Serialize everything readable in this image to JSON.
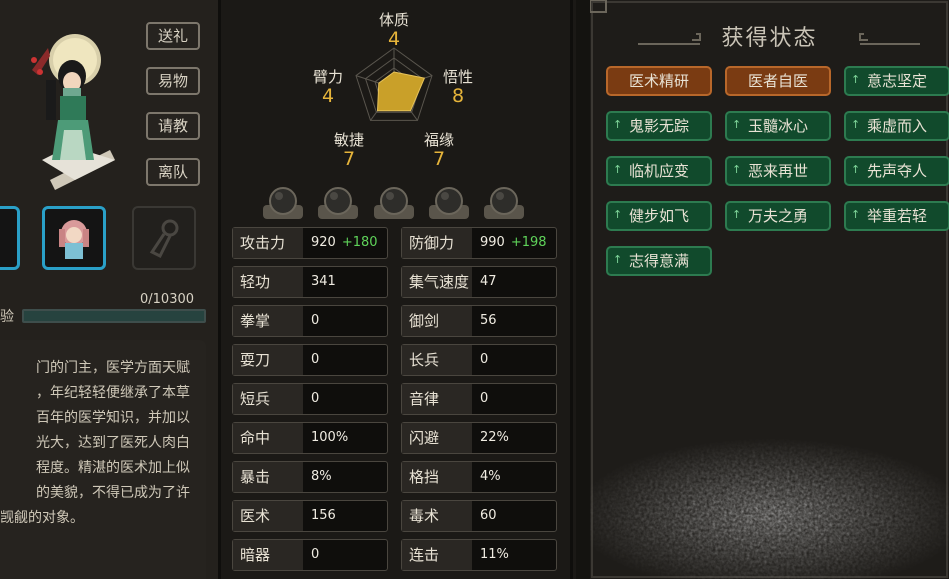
{
  "side_buttons": [
    "送礼",
    "易物",
    "请教",
    "离队"
  ],
  "xp": {
    "label": "验",
    "value": "0/10300",
    "fraction": 0.0
  },
  "bio": {
    "lines": [
      "门的门主，医学方面天赋",
      "，年纪轻轻便继承了本草",
      "百年的医学知识，并加以",
      "光大，达到了医死人肉白",
      "程度。精湛的医术加上似",
      "的美貌，不得已成为了许",
      "觊觎的对象。"
    ]
  },
  "radar": {
    "attributes": [
      {
        "name": "体质",
        "value": "4"
      },
      {
        "name": "悟性",
        "value": "8"
      },
      {
        "name": "福缘",
        "value": "7"
      },
      {
        "name": "敏捷",
        "value": "7"
      },
      {
        "name": "臂力",
        "value": "4"
      }
    ],
    "max": 10
  },
  "stats": [
    [
      {
        "name": "攻击力",
        "value": "920",
        "bonus": "+180"
      },
      {
        "name": "防御力",
        "value": "990",
        "bonus": "+198"
      }
    ],
    [
      {
        "name": "轻功",
        "value": "341"
      },
      {
        "name": "集气速度",
        "value": "47"
      }
    ],
    [
      {
        "name": "拳掌",
        "value": "0"
      },
      {
        "name": "御剑",
        "value": "56"
      }
    ],
    [
      {
        "name": "耍刀",
        "value": "0"
      },
      {
        "name": "长兵",
        "value": "0"
      }
    ],
    [
      {
        "name": "短兵",
        "value": "0"
      },
      {
        "name": "音律",
        "value": "0"
      }
    ],
    [
      {
        "name": "命中",
        "value": "100%"
      },
      {
        "name": "闪避",
        "value": "22%"
      }
    ],
    [
      {
        "name": "暴击",
        "value": "8%"
      },
      {
        "name": "格挡",
        "value": "4%"
      }
    ],
    [
      {
        "name": "医术",
        "value": "156"
      },
      {
        "name": "毒术",
        "value": "60"
      }
    ],
    [
      {
        "name": "暗器",
        "value": "0"
      },
      {
        "name": "连击",
        "value": "11%"
      }
    ]
  ],
  "status_panel": {
    "title": "获得状态",
    "tags": [
      {
        "label": "医术精研",
        "color": "orange"
      },
      {
        "label": "医者自医",
        "color": "orange"
      },
      {
        "label": "意志坚定",
        "color": "green"
      },
      {
        "label": "鬼影无踪",
        "color": "green"
      },
      {
        "label": "玉髓冰心",
        "color": "green"
      },
      {
        "label": "乘虚而入",
        "color": "green"
      },
      {
        "label": "临机应变",
        "color": "green"
      },
      {
        "label": "恶来再世",
        "color": "green"
      },
      {
        "label": "先声夺人",
        "color": "green"
      },
      {
        "label": "健步如飞",
        "color": "green"
      },
      {
        "label": "万夫之勇",
        "color": "green"
      },
      {
        "label": "举重若轻",
        "color": "green"
      },
      {
        "label": "志得意满",
        "color": "green"
      }
    ]
  },
  "colors": {
    "accent_gold": "#e6b43a",
    "bonus_green": "#5fd35a",
    "tag_orange": "#7a3b12",
    "tag_green": "#114a2c",
    "party_selected": "#2aa0c8"
  },
  "icons": [
    "character-portrait",
    "party-member-icon",
    "empty-slot-icon",
    "equipment-slot-ball-icon"
  ]
}
